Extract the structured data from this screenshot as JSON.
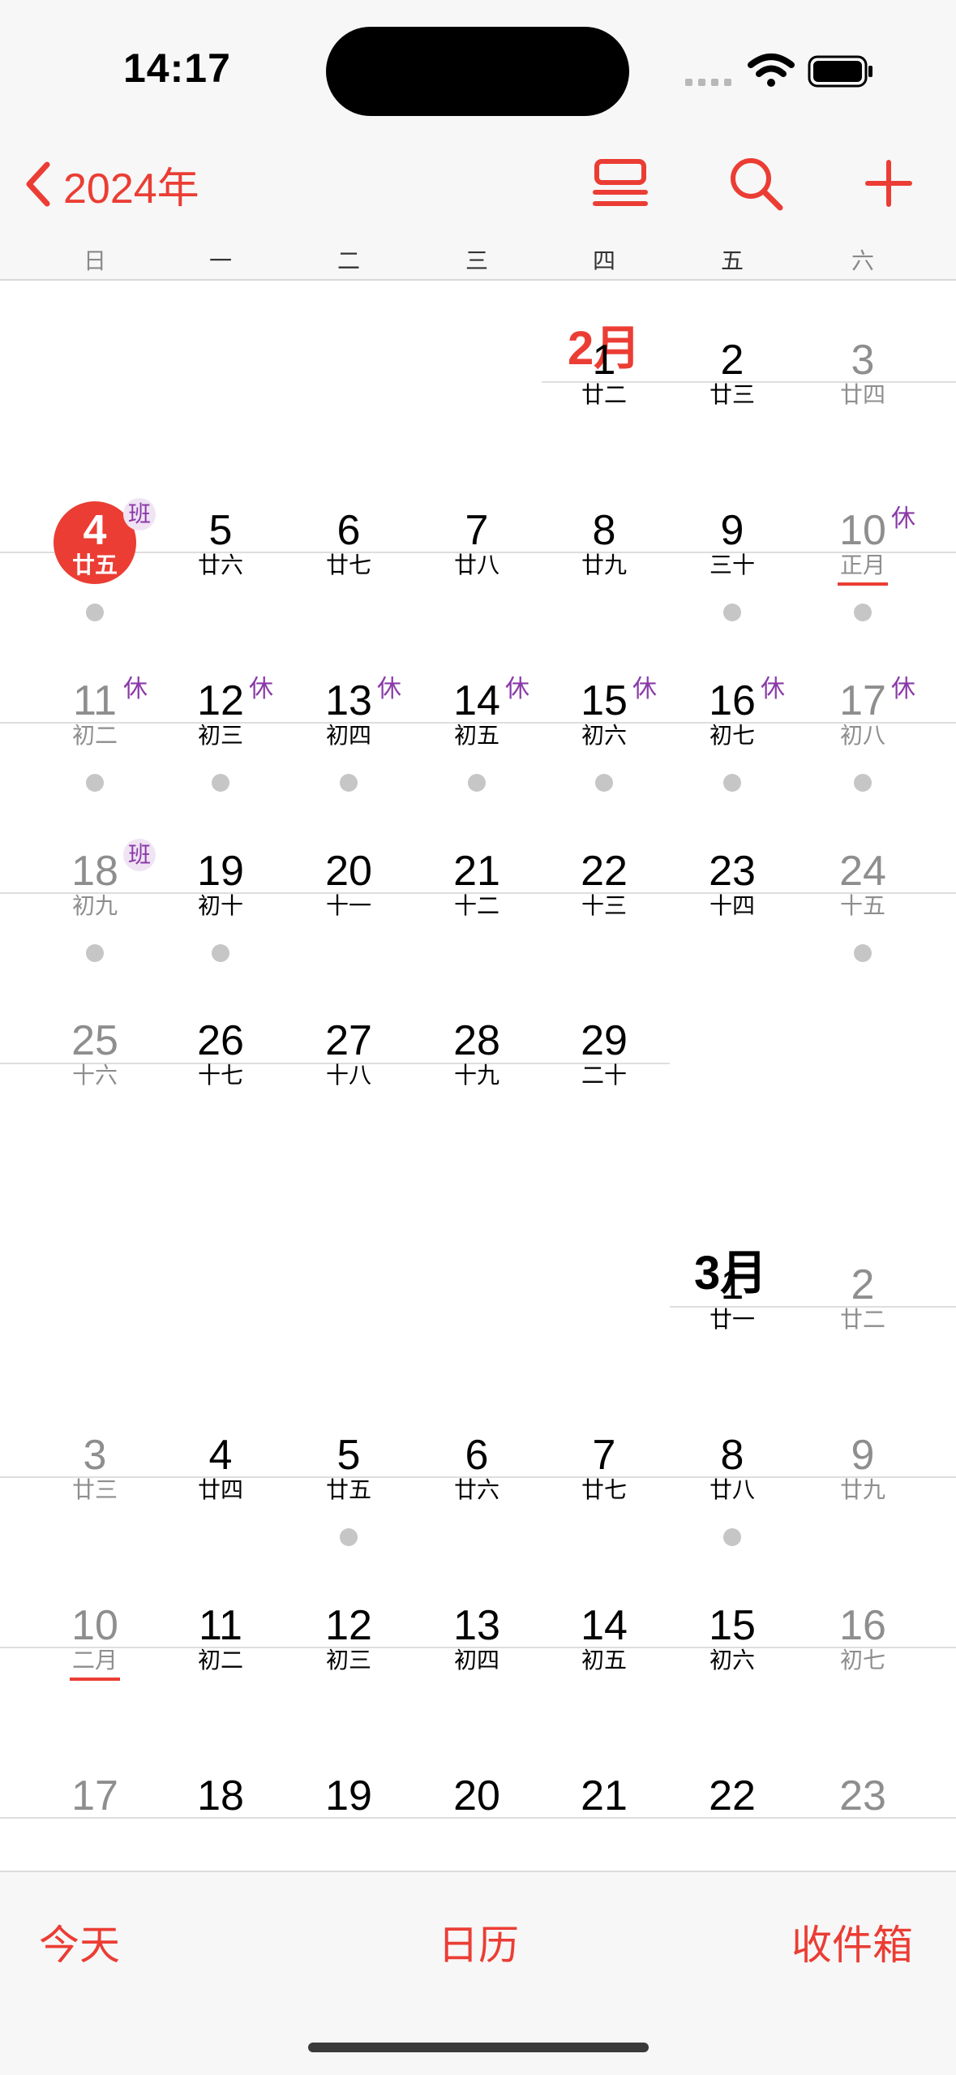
{
  "status_bar": {
    "time": "14:17"
  },
  "nav": {
    "back_label": "2024年"
  },
  "weekdays": [
    "日",
    "一",
    "二",
    "三",
    "四",
    "五",
    "六"
  ],
  "months": [
    {
      "title": "2月",
      "color": "#eb3d34"
    },
    {
      "title": "3月",
      "color": "#000000"
    }
  ],
  "colors": {
    "accent": "#eb3d34",
    "holiday_badge": "#8a3aa8",
    "event_dot": "#c6c6c6"
  },
  "badge_labels": {
    "rest": "休",
    "work": "班"
  },
  "weeks": [
    {
      "days": [
        {
          "col": 4,
          "num": "1",
          "lunar": "廿二"
        },
        {
          "col": 5,
          "num": "2",
          "lunar": "廿三"
        },
        {
          "col": 6,
          "num": "3",
          "lunar": "廿四",
          "gray": true
        }
      ]
    },
    {
      "days": [
        {
          "col": 0,
          "num": "4",
          "lunar": "廿五",
          "today": true,
          "badge": "班",
          "dot": true
        },
        {
          "col": 1,
          "num": "5",
          "lunar": "廿六"
        },
        {
          "col": 2,
          "num": "6",
          "lunar": "廿七"
        },
        {
          "col": 3,
          "num": "7",
          "lunar": "廿八"
        },
        {
          "col": 4,
          "num": "8",
          "lunar": "廿九"
        },
        {
          "col": 5,
          "num": "9",
          "lunar": "三十",
          "dot": true
        },
        {
          "col": 6,
          "num": "10",
          "lunar": "正月",
          "gray": true,
          "badge": "休",
          "dot": true,
          "underline": true
        }
      ]
    },
    {
      "days": [
        {
          "col": 0,
          "num": "11",
          "lunar": "初二",
          "gray": true,
          "badge": "休",
          "dot": true
        },
        {
          "col": 1,
          "num": "12",
          "lunar": "初三",
          "badge": "休",
          "dot": true
        },
        {
          "col": 2,
          "num": "13",
          "lunar": "初四",
          "badge": "休",
          "dot": true
        },
        {
          "col": 3,
          "num": "14",
          "lunar": "初五",
          "badge": "休",
          "dot": true
        },
        {
          "col": 4,
          "num": "15",
          "lunar": "初六",
          "badge": "休",
          "dot": true
        },
        {
          "col": 5,
          "num": "16",
          "lunar": "初七",
          "badge": "休",
          "dot": true
        },
        {
          "col": 6,
          "num": "17",
          "lunar": "初八",
          "gray": true,
          "badge": "休",
          "dot": true
        }
      ]
    },
    {
      "days": [
        {
          "col": 0,
          "num": "18",
          "lunar": "初九",
          "gray": true,
          "badge": "班",
          "dot": true
        },
        {
          "col": 1,
          "num": "19",
          "lunar": "初十",
          "dot": true
        },
        {
          "col": 2,
          "num": "20",
          "lunar": "十一"
        },
        {
          "col": 3,
          "num": "21",
          "lunar": "十二"
        },
        {
          "col": 4,
          "num": "22",
          "lunar": "十三"
        },
        {
          "col": 5,
          "num": "23",
          "lunar": "十四"
        },
        {
          "col": 6,
          "num": "24",
          "lunar": "十五",
          "gray": true,
          "dot": true
        }
      ]
    },
    {
      "days": [
        {
          "col": 0,
          "num": "25",
          "lunar": "十六",
          "gray": true
        },
        {
          "col": 1,
          "num": "26",
          "lunar": "十七"
        },
        {
          "col": 2,
          "num": "27",
          "lunar": "十八"
        },
        {
          "col": 3,
          "num": "28",
          "lunar": "十九"
        },
        {
          "col": 4,
          "num": "29",
          "lunar": "二十"
        }
      ]
    },
    {
      "days": [
        {
          "col": 5,
          "num": "1",
          "lunar": "廿一"
        },
        {
          "col": 6,
          "num": "2",
          "lunar": "廿二",
          "gray": true
        }
      ]
    },
    {
      "days": [
        {
          "col": 0,
          "num": "3",
          "lunar": "廿三",
          "gray": true
        },
        {
          "col": 1,
          "num": "4",
          "lunar": "廿四"
        },
        {
          "col": 2,
          "num": "5",
          "lunar": "廿五",
          "dot": true
        },
        {
          "col": 3,
          "num": "6",
          "lunar": "廿六"
        },
        {
          "col": 4,
          "num": "7",
          "lunar": "廿七"
        },
        {
          "col": 5,
          "num": "8",
          "lunar": "廿八",
          "dot": true
        },
        {
          "col": 6,
          "num": "9",
          "lunar": "廿九",
          "gray": true
        }
      ]
    },
    {
      "days": [
        {
          "col": 0,
          "num": "10",
          "lunar": "二月",
          "gray": true,
          "underline": true
        },
        {
          "col": 1,
          "num": "11",
          "lunar": "初二"
        },
        {
          "col": 2,
          "num": "12",
          "lunar": "初三"
        },
        {
          "col": 3,
          "num": "13",
          "lunar": "初四"
        },
        {
          "col": 4,
          "num": "14",
          "lunar": "初五"
        },
        {
          "col": 5,
          "num": "15",
          "lunar": "初六"
        },
        {
          "col": 6,
          "num": "16",
          "lunar": "初七",
          "gray": true
        }
      ]
    },
    {
      "days": [
        {
          "col": 0,
          "num": "17",
          "gray": true
        },
        {
          "col": 1,
          "num": "18"
        },
        {
          "col": 2,
          "num": "19"
        },
        {
          "col": 3,
          "num": "20"
        },
        {
          "col": 4,
          "num": "21"
        },
        {
          "col": 5,
          "num": "22"
        },
        {
          "col": 6,
          "num": "23",
          "gray": true
        }
      ]
    }
  ],
  "toolbar": {
    "today": "今天",
    "calendars": "日历",
    "inbox": "收件箱"
  }
}
